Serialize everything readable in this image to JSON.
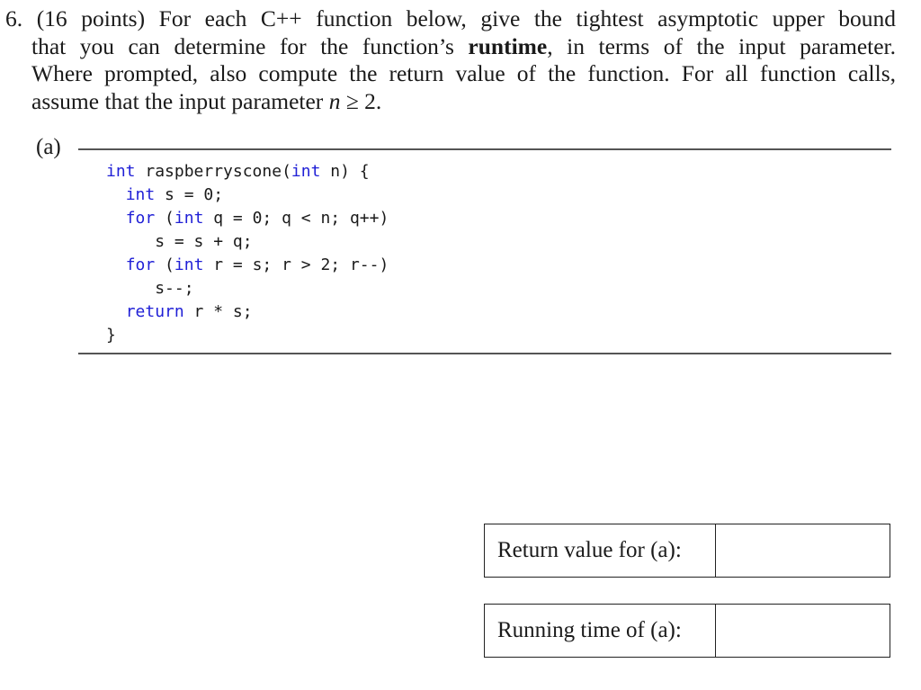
{
  "problem": {
    "number": "6.",
    "points": "(16 points)",
    "line1_rest": "For each C++ function below, give the tightest asymptotic upper bound",
    "line2_before_bold": "that you can determine for the function’s ",
    "line2_bold": "runtime",
    "line2_after_bold": ", in terms of the input parameter.",
    "line3": "Where prompted, also compute the return value of the function. For all function calls,",
    "line4_before_math": "assume that the input parameter ",
    "line4_math_var": "n",
    "line4_math_rest": " ≥ 2."
  },
  "part": {
    "label": "(a)",
    "code": [
      {
        "indent": "",
        "tokens": [
          {
            "t": "int",
            "kw": true
          },
          {
            "t": " raspberryscone(",
            "kw": false
          },
          {
            "t": "int",
            "kw": true
          },
          {
            "t": " n) {",
            "kw": false
          }
        ]
      },
      {
        "indent": "  ",
        "tokens": [
          {
            "t": "int",
            "kw": true
          },
          {
            "t": " s = 0;",
            "kw": false
          }
        ]
      },
      {
        "indent": "  ",
        "tokens": [
          {
            "t": "for",
            "kw": true
          },
          {
            "t": " (",
            "kw": false
          },
          {
            "t": "int",
            "kw": true
          },
          {
            "t": " q = 0; q < n; q++)",
            "kw": false
          }
        ]
      },
      {
        "indent": "     ",
        "tokens": [
          {
            "t": "s = s + q;",
            "kw": false
          }
        ]
      },
      {
        "indent": "  ",
        "tokens": [
          {
            "t": "for",
            "kw": true
          },
          {
            "t": " (",
            "kw": false
          },
          {
            "t": "int",
            "kw": true
          },
          {
            "t": " r = s; r > 2; r--)",
            "kw": false
          }
        ]
      },
      {
        "indent": "     ",
        "tokens": [
          {
            "t": "s--;",
            "kw": false
          }
        ]
      },
      {
        "indent": "  ",
        "tokens": [
          {
            "t": "return",
            "kw": true
          },
          {
            "t": " r * s;",
            "kw": false
          }
        ]
      },
      {
        "indent": "",
        "tokens": [
          {
            "t": "}",
            "kw": false
          }
        ]
      }
    ]
  },
  "answers": {
    "return_label": "Return value for (a):",
    "return_value": "",
    "runtime_label": "Running time of (a):",
    "runtime_value": ""
  },
  "colors": {
    "keyword": "#1f1fd6",
    "text": "#1a1a1a",
    "rule": "#555555"
  }
}
